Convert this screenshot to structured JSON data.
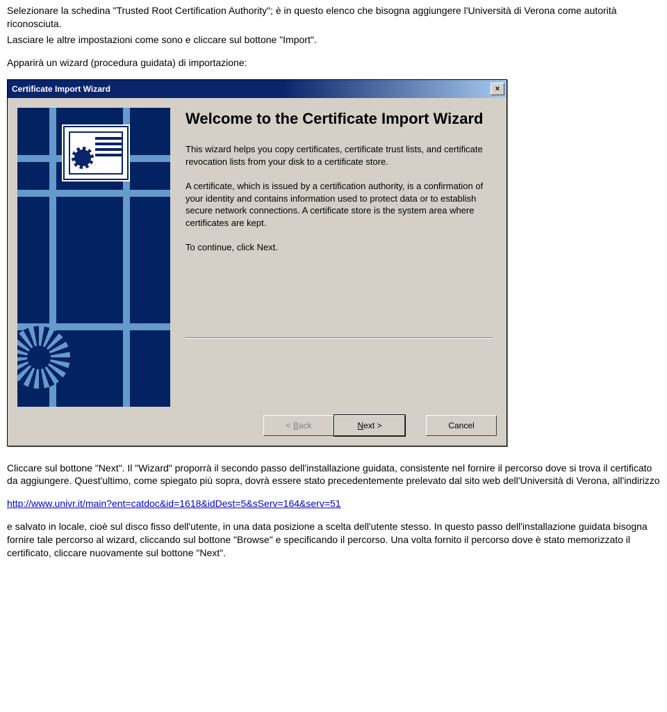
{
  "doc": {
    "p1": "Selezionare la schedina \"Trusted Root Certification Authority\"; è in questo elenco che bisogna aggiungere l'Università di Verona come autorità riconosciuta.",
    "p2": "Lasciare le altre impostazioni come sono e cliccare sul bottone \"Import\".",
    "p3": "Apparirà un wizard (procedura guidata) di importazione:",
    "p4": "Cliccare sul bottone \"Next\". Il \"Wizard\" proporrà il secondo passo dell'installazione guidata, consistente nel fornire il percorso dove si trova il certificato da aggiungere. Quest'ultimo, come spiegato più sopra, dovrà essere stato precedentemente prelevato dal sito web dell'Università di Verona, all'indirizzo",
    "link": "http://www.univr.it/main?ent=catdoc&id=1618&idDest=5&sServ=164&serv=51",
    "p5": "e salvato in locale, cioè sul disco fisso dell'utente, in una data posizione a scelta dell'utente stesso. In questo passo dell'installazione guidata bisogna fornire tale percorso al wizard, cliccando sul bottone \"Browse\" e specificando il percorso. Una volta fornito il percorso dove è stato memorizzato il certificato, cliccare nuovamente sul bottone \"Next\"."
  },
  "wizard": {
    "titlebar": "Certificate Import Wizard",
    "close": "×",
    "heading": "Welcome to the Certificate Import Wizard",
    "body1": "This wizard helps you copy certificates, certificate trust lists, and certificate revocation lists from your disk to a certificate store.",
    "body2": "A certificate, which is issued by a certification authority, is a confirmation of your identity and contains information used to protect data or to establish secure network connections. A certificate store is the system area where certificates are kept.",
    "body3": "To continue, click Next.",
    "btn_back_pre": "< ",
    "btn_back_u": "B",
    "btn_back_post": "ack",
    "btn_next_u": "N",
    "btn_next_post": "ext >",
    "btn_cancel": "Cancel"
  }
}
